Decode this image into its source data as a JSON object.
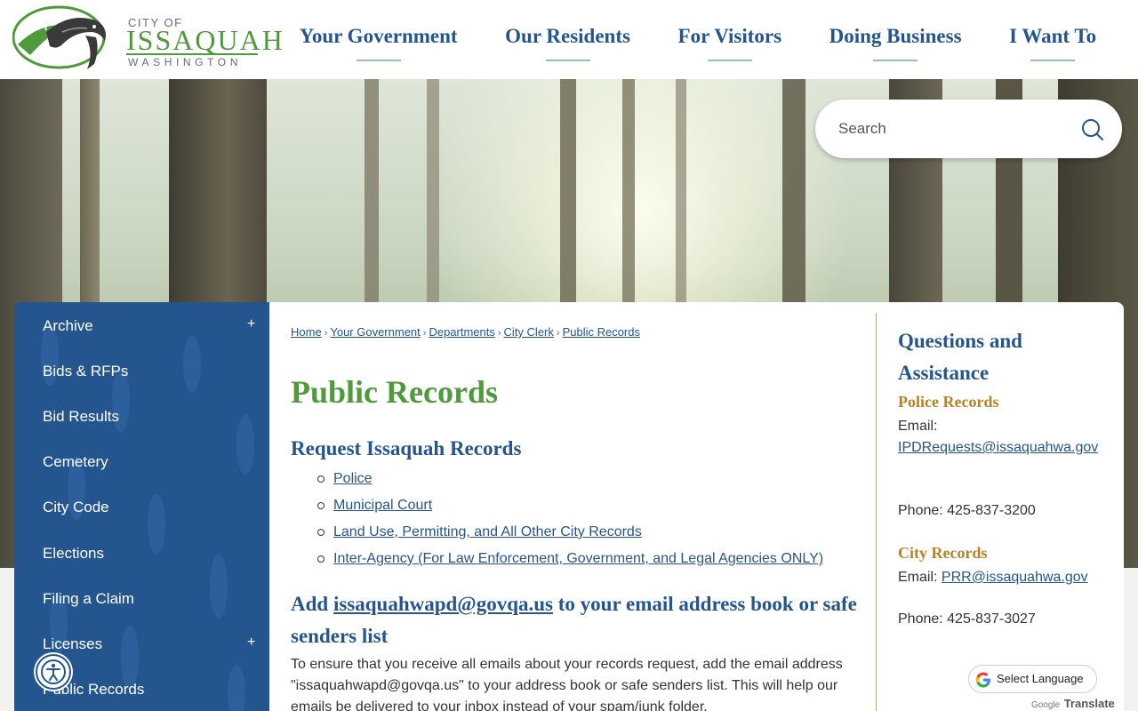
{
  "logo": {
    "city_of": "CITY OF",
    "name": "ISSAQUAH",
    "state": "WASHINGTON"
  },
  "nav": [
    {
      "label": "Your Government"
    },
    {
      "label": "Our Residents"
    },
    {
      "label": "For Visitors"
    },
    {
      "label": "Doing Business"
    },
    {
      "label": "I Want To"
    }
  ],
  "search": {
    "placeholder": "Search"
  },
  "sidebar": {
    "items": [
      {
        "label": "Archive",
        "expandable": true,
        "plus": "+"
      },
      {
        "label": "Bids & RFPs"
      },
      {
        "label": "Bid Results"
      },
      {
        "label": "Cemetery"
      },
      {
        "label": "City Code"
      },
      {
        "label": "Elections"
      },
      {
        "label": "Filing a Claim"
      },
      {
        "label": "Licenses",
        "expandable": true,
        "plus": "+"
      },
      {
        "label": "Public Records"
      }
    ]
  },
  "breadcrumb": [
    {
      "label": "Home"
    },
    {
      "label": "Your Government"
    },
    {
      "label": "Departments"
    },
    {
      "label": "City Clerk"
    },
    {
      "label": "Public Records"
    }
  ],
  "breadcrumb_sep": "›",
  "main": {
    "title": "Public Records",
    "request_heading": "Request Issaquah Records",
    "request_links": [
      {
        "label": "Police"
      },
      {
        "label": "Municipal Court"
      },
      {
        "label": "Land Use, Permitting, and All Other City Records"
      },
      {
        "label": "Inter-Agency (For Law Enforcement, Government, and Legal Agencies ONLY)"
      }
    ],
    "add_heading_prefix": "Add ",
    "add_heading_email": "issaquahwapd@govqa.us",
    "add_heading_suffix": " to your email address book or safe senders list",
    "body_text": "To ensure that you receive all emails about your records request, add the email address \"issaquahwapd@govqa.us\" to your address book or safe senders list. This will help our emails be delivered to your inbox instead of your spam/junk folder."
  },
  "right": {
    "heading": "Questions and Assistance",
    "police": {
      "title": "Police Records",
      "email_label": "Email:",
      "email": "IPDRequests@issaquahwa.gov",
      "phone": "Phone: 425-837-3200"
    },
    "city": {
      "title": "City Records",
      "email_label": "Email:",
      "email": "PRR@issaquahwa.gov",
      "phone": "Phone: 425-837-3027"
    }
  },
  "translate": {
    "label": "Select Language",
    "powered_google": "Google",
    "powered_translate": "Translate"
  },
  "colors": {
    "brand_blue": "#24558e",
    "brand_green": "#4f9a3a",
    "accent_gold": "#b5822a"
  }
}
